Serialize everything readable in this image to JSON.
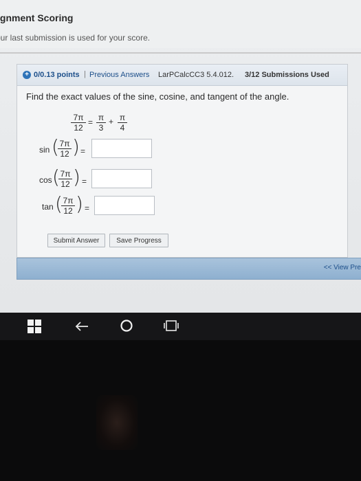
{
  "assignment": {
    "title": "ignment Scoring",
    "subtitle": "our last submission is used for your score."
  },
  "question": {
    "points": "0/0.13 points",
    "separator": "|",
    "previous_answers": "Previous Answers",
    "course_ref": "LarPCalcCC3 5.4.012.",
    "submissions": "3/12 Submissions Used",
    "prompt": "Find the exact values of the sine, cosine, and tangent of the angle.",
    "identity": {
      "lhs_num": "7π",
      "lhs_den": "12",
      "eq": "=",
      "t1_num": "π",
      "t1_den": "3",
      "plus": "+",
      "t2_num": "π",
      "t2_den": "4"
    },
    "rows": [
      {
        "fn": "sin",
        "num": "7π",
        "den": "12",
        "eq": "=",
        "value": ""
      },
      {
        "fn": "cos",
        "num": "7π",
        "den": "12",
        "eq": "=",
        "value": ""
      },
      {
        "fn": "tan",
        "num": "7π",
        "den": "12",
        "eq": "=",
        "value": ""
      }
    ],
    "submit_label": "Submit Answer",
    "save_label": "Save Progress"
  },
  "nav": {
    "view_previous": "<< View Pre"
  },
  "taskbar": {
    "icons": [
      "windows-icon",
      "back-arrow-icon",
      "search-circle-icon",
      "task-view-icon"
    ]
  },
  "colors": {
    "accent": "#1d4f8a",
    "navbar": "#9bb9d6",
    "taskbar": "#161618"
  }
}
